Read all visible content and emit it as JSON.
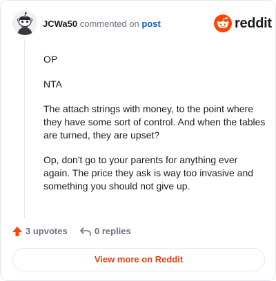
{
  "header": {
    "username": "JCWa50",
    "action_text": "commented on",
    "post_link": "post",
    "logo_text": "reddit",
    "brand_color": "#ff4500"
  },
  "comment": {
    "paragraphs": [
      "OP",
      "NTA",
      "The attach strings with money, to the point where they have some sort of control. And when the tables are turned, they are upset?",
      "Op, don't go to your parents for anything ever again. The price they ask is way too invasive and something you should not give up."
    ]
  },
  "actions": {
    "upvotes_label": "3 upvotes",
    "replies_label": "0 replies",
    "upvote_color": "#ff4500"
  },
  "footer": {
    "view_more_label": "View more on Reddit",
    "link_color": "#e8410f"
  }
}
